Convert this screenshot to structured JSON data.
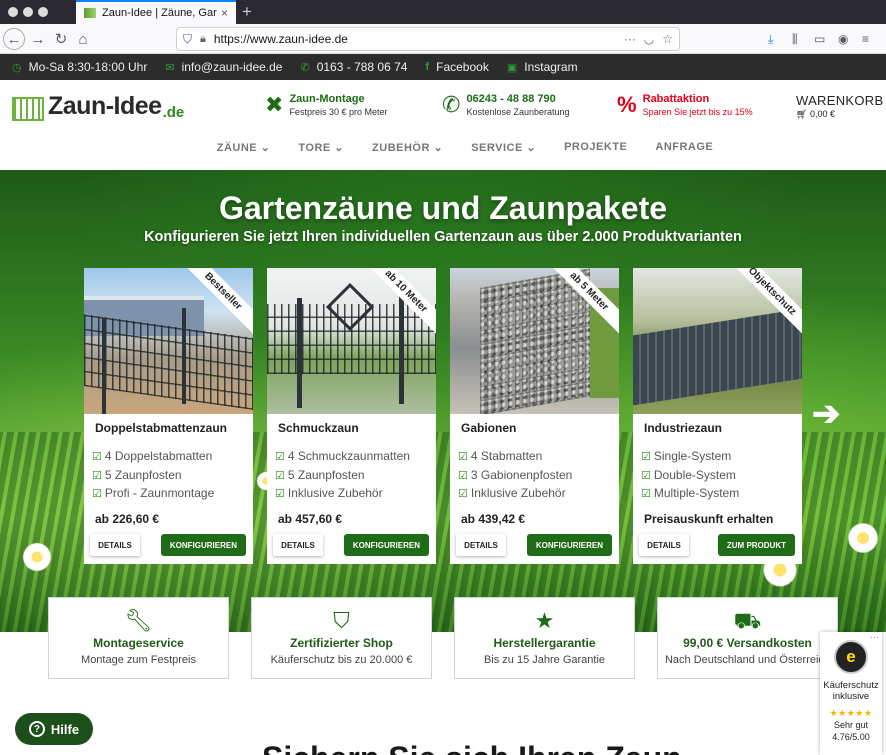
{
  "browser": {
    "tab_title": "Zaun-Idee | Zäune, Gartentore u",
    "tab_close": "×",
    "new_tab": "+",
    "url": "https://www.zaun-idee.de",
    "url_more": "···"
  },
  "infobar": {
    "hours": "Mo-Sa 8:30-18:00 Uhr",
    "email": "info@zaun-idee.de",
    "phone": "0163 - 788 06 74",
    "facebook": "Facebook",
    "instagram": "Instagram"
  },
  "header": {
    "logo_text": "Zaun-Idee",
    "logo_tld": ".de",
    "usp_montage_title": "Zaun-Montage",
    "usp_montage_sub": "Festpreis 30 € pro Meter",
    "usp_phone_title": "06243 - 48 88 790",
    "usp_phone_sub": "Kostenlose Zaunberatung",
    "usp_sale_title": "Rabattaktion",
    "usp_sale_sub": "Sparen Sie jetzt bis zu 15%",
    "cart_label": "WARENKORB",
    "cart_total": "0,00 €"
  },
  "menu": [
    "ZÄUNE ⌄",
    "TORE ⌄",
    "ZUBEHÖR ⌄",
    "SERVICE ⌄",
    "PROJEKTE",
    "ANFRAGE"
  ],
  "hero": {
    "title": "Gartenzäune und Zaunpakete",
    "subtitle": "Konfigurieren Sie jetzt Ihren individuellen Gartenzaun aus über 2.000 Produktvarianten",
    "next_arrow": "➔"
  },
  "cards": [
    {
      "ribbon": "Bestseller",
      "title": "Doppelstabmattenzaun",
      "features": [
        "4 Doppelstabmatten",
        "5 Zaunpfosten",
        "Profi - Zaunmontage"
      ],
      "price": "ab 226,60 €",
      "details": "DETAILS",
      "action": "KONFIGURIEREN"
    },
    {
      "ribbon": "ab 10 Meter",
      "title": "Schmuckzaun",
      "features": [
        "4 Schmuckzaunmatten",
        "5 Zaunpfosten",
        "Inklusive Zubehör"
      ],
      "price": "ab 457,60 €",
      "details": "DETAILS",
      "action": "KONFIGURIEREN"
    },
    {
      "ribbon": "ab 5 Meter",
      "title": "Gabionen",
      "features": [
        "4 Stabmatten",
        "3 Gabionenpfosten",
        "Inklusive Zubehör"
      ],
      "price": "ab 439,42 €",
      "details": "DETAILS",
      "action": "KONFIGURIEREN"
    },
    {
      "ribbon": "Objektschutz",
      "title": "Industriezaun",
      "features": [
        "Single-System",
        "Double-System",
        "Multiple-System"
      ],
      "price": "Preisauskunft erhalten",
      "details": "DETAILS",
      "action": "ZUM PRODUKT"
    }
  ],
  "features": [
    {
      "icon": "wrench-icon",
      "title": "Montageservice",
      "sub": "Montage zum Festpreis"
    },
    {
      "icon": "shield-icon",
      "title": "Zertifizierter Shop",
      "sub": "Käuferschutz bis zu 20.000 €"
    },
    {
      "icon": "star-icon",
      "title": "Herstellergarantie",
      "sub": "Bis zu 15 Jahre Garantie"
    },
    {
      "icon": "truck-icon",
      "title": "99,00 € Versandkosten",
      "sub": "Nach Deutschland und Österreich"
    }
  ],
  "help": {
    "label": "Hilfe",
    "icon": "?"
  },
  "bottom_heading": "Sichern Sie sich Ihren Zaun",
  "trust": {
    "seal": "e",
    "line1": "Käuferschutz",
    "line2": "inklusive",
    "stars": "★★★★★",
    "rating_text": "Sehr gut",
    "score": "4.76/5.00",
    "more": "···"
  },
  "colors": {
    "brand_green": "#1f6b18",
    "accent_red": "#e3001b",
    "infobar_bg": "#2c2c2c"
  }
}
